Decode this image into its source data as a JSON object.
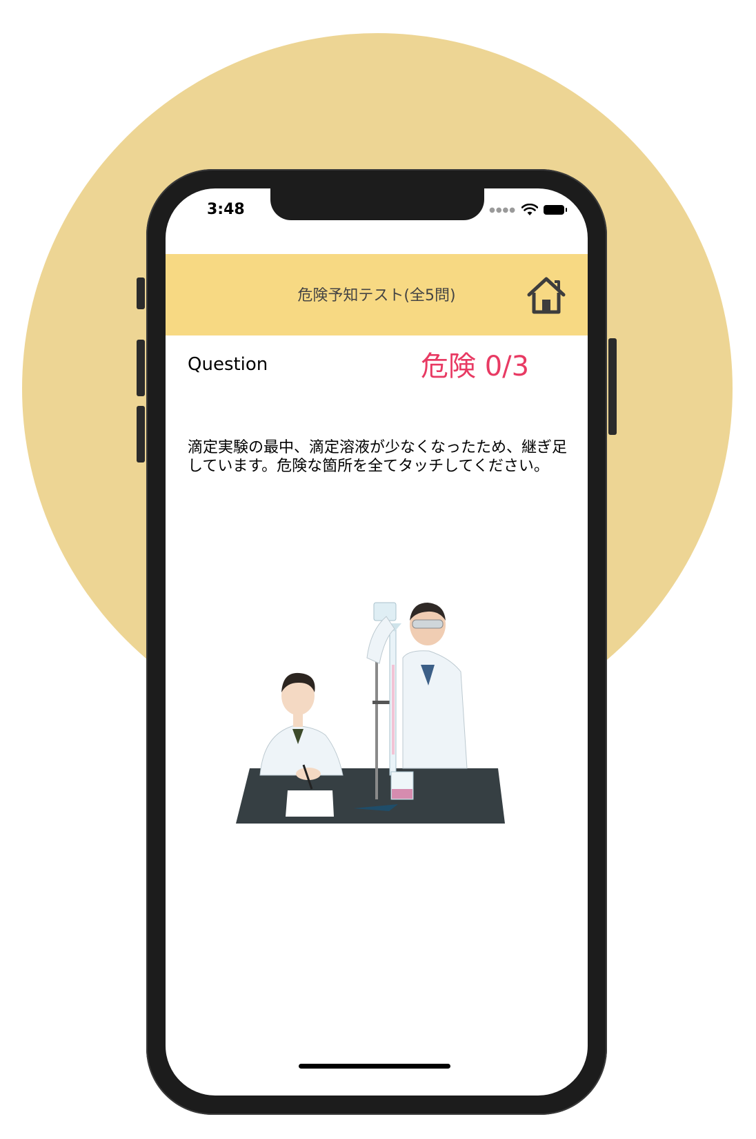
{
  "status_bar": {
    "time": "3:48"
  },
  "header": {
    "title": "危険予知テスト(全5問)",
    "home_icon": "home-icon"
  },
  "question": {
    "label": "Question",
    "danger_counter": "危険 0/3",
    "text": "滴定実験の最中、滴定溶液が少なくなったため、継ぎ足しています。危険な箇所を全てタッチしてください。"
  },
  "colors": {
    "header_bg": "#f7d983",
    "background_circle": "#edd594",
    "danger_text": "#e83a63"
  }
}
